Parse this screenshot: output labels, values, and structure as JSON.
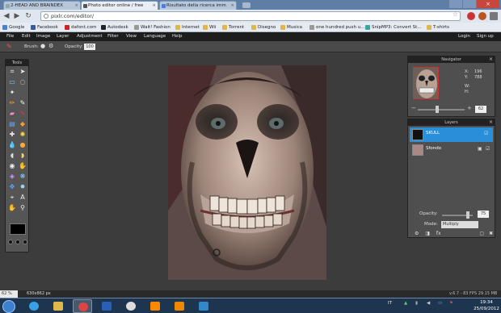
{
  "browser": {
    "tabs": [
      {
        "label": "2-HEAD AND BRAINDEX"
      },
      {
        "label": "Photo editor online / free"
      },
      {
        "label": "Risultato della ricerca imm"
      }
    ],
    "address": "pixlr.com/editor/",
    "bookmarks": [
      {
        "label": "Google"
      },
      {
        "label": "Facebook"
      },
      {
        "label": "dafont.com"
      },
      {
        "label": "Autodesk"
      },
      {
        "label": "Wait! Fashion"
      },
      {
        "label": "Internet"
      },
      {
        "label": "Wii"
      },
      {
        "label": "Torrent"
      },
      {
        "label": "Disegno"
      },
      {
        "label": "Musica"
      },
      {
        "label": "one hundred push u..."
      },
      {
        "label": "SnipMP3: Convert St..."
      },
      {
        "label": "T-shirts"
      }
    ]
  },
  "app": {
    "menu": [
      "File",
      "Edit",
      "Image",
      "Layer",
      "Adjustment",
      "Filter",
      "View",
      "Language",
      "Help"
    ],
    "login": "Login",
    "signup": "Sign up",
    "options": {
      "brush_label": "Brush:",
      "opacity_label": "Opacity:",
      "opacity_value": "100"
    },
    "tools_title": "Tools",
    "navigator": {
      "title": "Navigator",
      "x_label": "X:",
      "x_value": "196",
      "y_label": "Y:",
      "y_value": "788",
      "w_label": "W:",
      "h_label": "H:",
      "zoom": "62"
    },
    "layers": {
      "title": "Layers",
      "items": [
        {
          "name": "SKULL",
          "selected": true
        },
        {
          "name": "Sfondo",
          "selected": false
        }
      ],
      "opacity_label": "Opacity:",
      "opacity_value": "75",
      "mode_label": "Mode:",
      "mode_value": "Multiply"
    },
    "status": {
      "zoom": "62",
      "zoom_unit": "%",
      "dims": "630x862 px",
      "fps": "v.6.7 - 83 FPS 29.15 MB"
    }
  },
  "taskbar": {
    "lang": "IT",
    "time": "19:34",
    "date": "25/09/2012"
  },
  "colors": {
    "accent": "#2b8ed8",
    "app_bg": "#3c3c3c",
    "panel_bg": "#4f4f4f"
  }
}
